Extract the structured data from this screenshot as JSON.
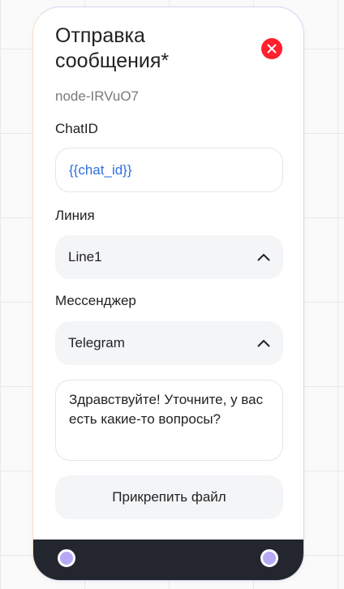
{
  "node": {
    "title": "Отправка сообщения*",
    "id_text": "node-IRVuO7",
    "close_icon": "close-icon",
    "colors": {
      "close_button": "#ff1f2d",
      "variable_text": "#2f6fe0",
      "footer": "#23262e",
      "port": "#b6a9f5"
    }
  },
  "fields": {
    "chat_id": {
      "label": "ChatID",
      "value": "{{chat_id}}"
    },
    "line": {
      "label": "Линия",
      "value": "Line1",
      "icon": "chevron-up-icon"
    },
    "messenger": {
      "label": "Мессенджер",
      "value": "Telegram",
      "icon": "chevron-up-icon"
    },
    "message": {
      "value": "Здравствуйте! Уточните, у вас есть какие-то вопросы?"
    }
  },
  "buttons": {
    "attach_label": "Прикрепить файл"
  },
  "footer": {
    "ports": [
      "input-port",
      "output-port"
    ]
  }
}
